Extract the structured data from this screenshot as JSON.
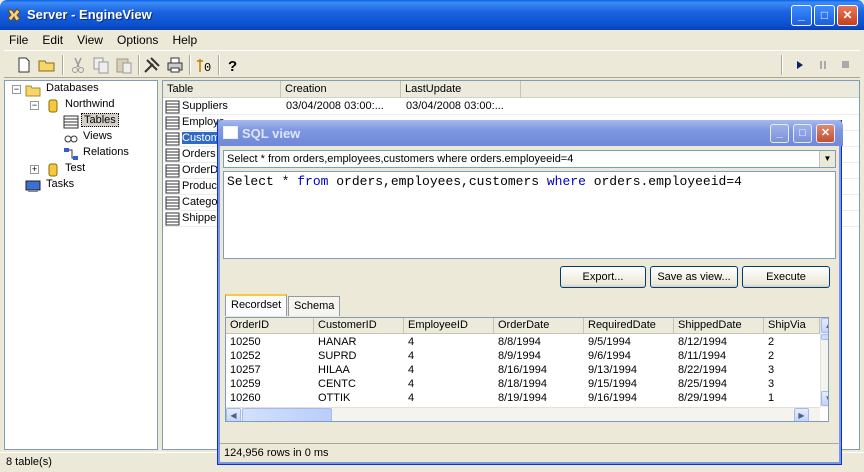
{
  "window": {
    "title": "Server - EngineView"
  },
  "menu": [
    "File",
    "Edit",
    "View",
    "Options",
    "Help"
  ],
  "tree": {
    "databases": "Databases",
    "northwind": "Northwind",
    "tables": "Tables",
    "views": "Views",
    "relations": "Relations",
    "test": "Test",
    "tasks": "Tasks"
  },
  "list": {
    "headers": [
      "Table",
      "Creation",
      "LastUpdate"
    ],
    "rows": [
      {
        "name": "Suppliers",
        "creation": "03/04/2008 03:00:...",
        "update": "03/04/2008 03:00:..."
      },
      {
        "name": "Employe",
        "creation": "",
        "update": ""
      },
      {
        "name": "Custom",
        "creation": "",
        "update": ""
      },
      {
        "name": "Orders",
        "creation": "",
        "update": ""
      },
      {
        "name": "OrderD",
        "creation": "",
        "update": ""
      },
      {
        "name": "Product",
        "creation": "",
        "update": ""
      },
      {
        "name": "Catego",
        "creation": "",
        "update": ""
      },
      {
        "name": "Shipper",
        "creation": "",
        "update": ""
      }
    ]
  },
  "status": "8 table(s)",
  "sqlview": {
    "title": "SQL view",
    "combo": "Select * from orders,employees,customers where orders.employeeid=4",
    "query": {
      "p1": "Select * ",
      "k1": "from",
      "p2": " orders,employees,customers ",
      "k2": "where",
      "p3": " orders.employeeid=4"
    },
    "buttons": {
      "export": "Export...",
      "save": "Save as view...",
      "execute": "Execute"
    },
    "tabs": [
      "Recordset",
      "Schema"
    ],
    "columns": [
      "OrderID",
      "CustomerID",
      "EmployeeID",
      "OrderDate",
      "RequiredDate",
      "ShippedDate",
      "ShipVia"
    ],
    "rows": [
      [
        "10250",
        "HANAR",
        "4",
        "8/8/1994",
        "9/5/1994",
        "8/12/1994",
        "2"
      ],
      [
        "10252",
        "SUPRD",
        "4",
        "8/9/1994",
        "9/6/1994",
        "8/11/1994",
        "2"
      ],
      [
        "10257",
        "HILAA",
        "4",
        "8/16/1994",
        "9/13/1994",
        "8/22/1994",
        "3"
      ],
      [
        "10259",
        "CENTC",
        "4",
        "8/18/1994",
        "9/15/1994",
        "8/25/1994",
        "3"
      ],
      [
        "10260",
        "OTTIK",
        "4",
        "8/19/1994",
        "9/16/1994",
        "8/29/1994",
        "1"
      ]
    ],
    "status": "124,956 rows in 0 ms"
  }
}
